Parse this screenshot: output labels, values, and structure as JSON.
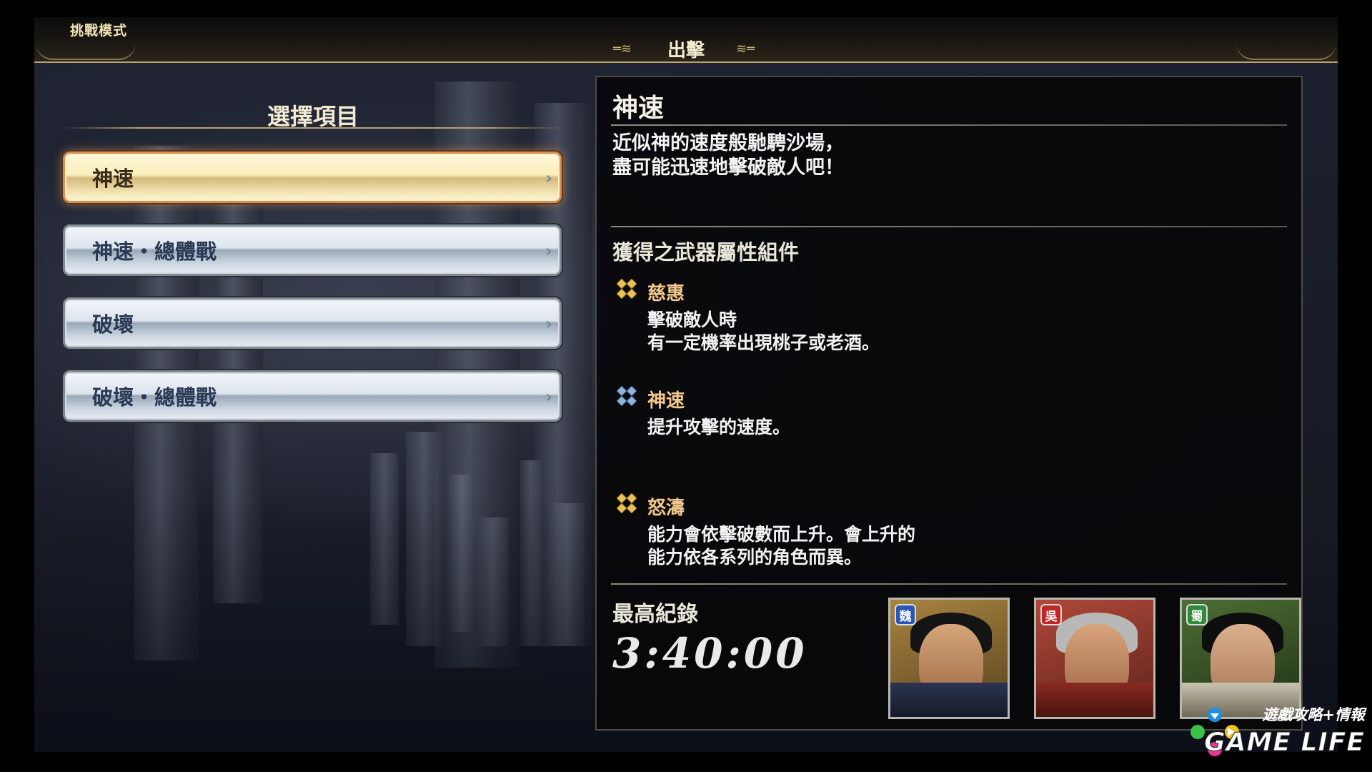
{
  "header": {
    "mode_title": "挑戰模式",
    "center_title": "出擊"
  },
  "menu": {
    "title": "選擇項目",
    "items": [
      {
        "label": "神速",
        "selected": true
      },
      {
        "label": "神速・總體戰",
        "selected": false
      },
      {
        "label": "破壞",
        "selected": false
      },
      {
        "label": "破壞・總體戰",
        "selected": false
      }
    ]
  },
  "detail": {
    "title": "神速",
    "description_line1": "近似神的速度般馳騁沙場，",
    "description_line2": "盡可能迅速地擊破敵人吧！",
    "components_title": "獲得之武器屬性組件",
    "attributes": [
      {
        "name": "慈惠",
        "line1": "擊破敵人時",
        "line2": "有一定機率出現桃子或老酒。",
        "icon": "gold-cross-icon"
      },
      {
        "name": "神速",
        "line1": "提升攻擊的速度。",
        "line2": "",
        "icon": "blue-cross-icon"
      },
      {
        "name": "怒濤",
        "line1": "能力會依擊破數而上升。會上升的",
        "line2": "能力依各系列的角色而異。",
        "icon": "gold-cross-icon"
      }
    ],
    "record_label": "最高紀錄",
    "record_time": "3:40:00"
  },
  "portraits": [
    {
      "faction": "魏",
      "badge_color": "#2b56b8",
      "bg": "#8a6a30"
    },
    {
      "faction": "吳",
      "badge_color": "#c02626",
      "bg": "#8c3a2c"
    },
    {
      "faction": "蜀",
      "badge_color": "#2f8a3a",
      "bg": "#3d5a2c"
    }
  ],
  "watermark": {
    "line1": "遊戲攻略+情報",
    "line2": "GAME LIFE"
  },
  "colors": {
    "accent_gold": "#b9a56a",
    "selected_glow": "#d89050",
    "attr_name": "#f3c88c"
  }
}
